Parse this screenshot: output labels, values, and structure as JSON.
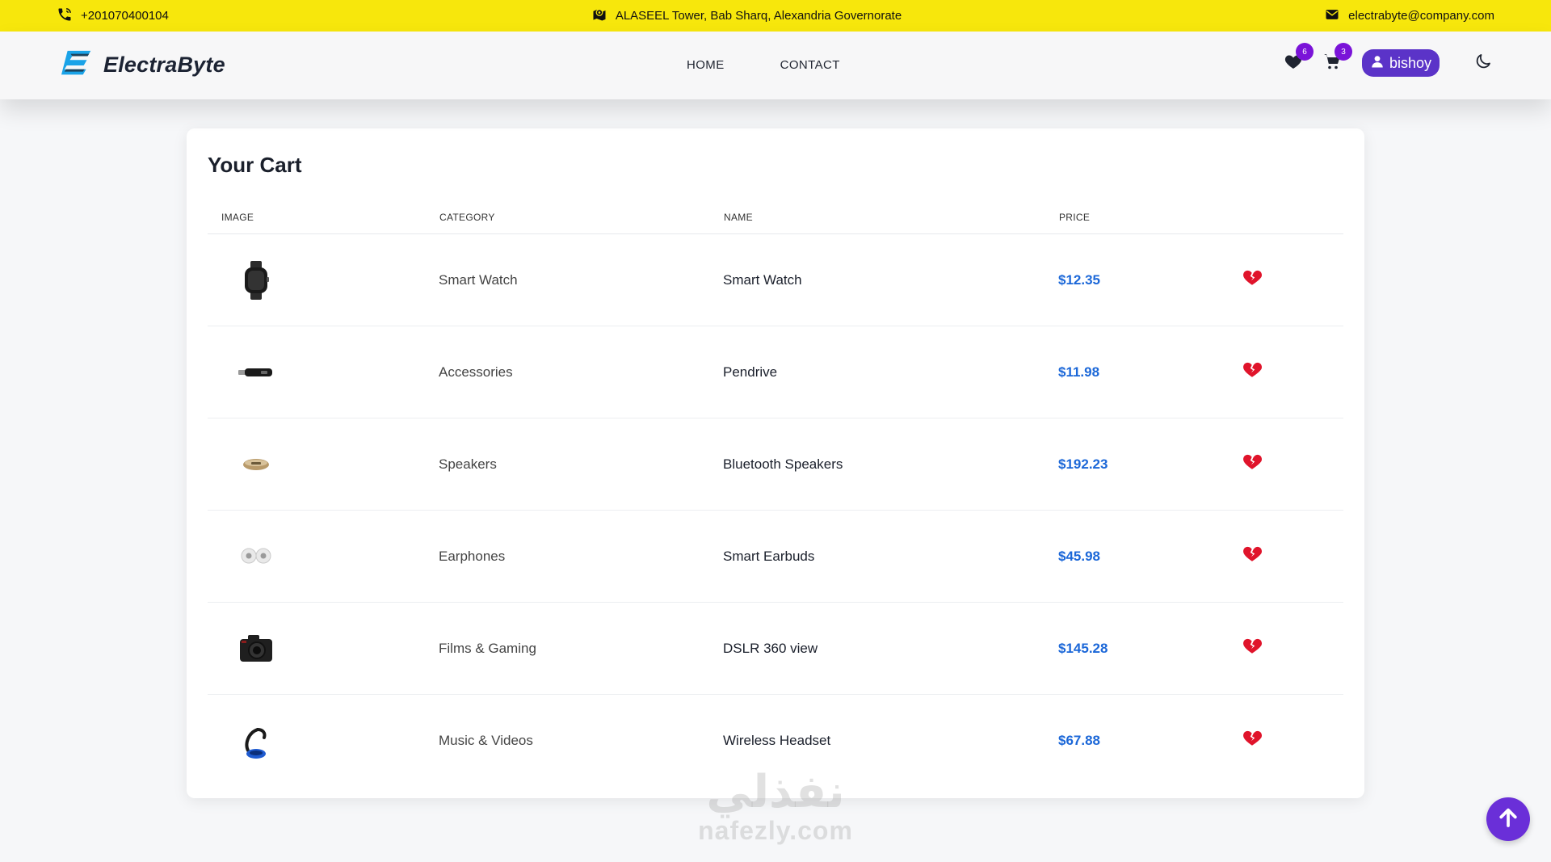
{
  "topbar": {
    "phone": "+201070400104",
    "address": "ALASEEL Tower, Bab Sharq, Alexandria Governorate",
    "email": "electrabyte@company.com",
    "background": "#f7e70c"
  },
  "nav": {
    "brand": "ElectraByte",
    "links": [
      {
        "label": "HOME"
      },
      {
        "label": "CONTACT"
      }
    ],
    "wishlist_count": "6",
    "cart_count": "3",
    "user_label": "bishoy",
    "accent": "#5b33c8"
  },
  "cart": {
    "title": "Your Cart",
    "columns": [
      "IMAGE",
      "CATEGORY",
      "NAME",
      "PRICE"
    ],
    "items": [
      {
        "image_icon": "smart-watch-icon",
        "category": "Smart Watch",
        "name": "Smart Watch",
        "price": "$12.35"
      },
      {
        "image_icon": "pendrive-icon",
        "category": "Accessories",
        "name": "Pendrive",
        "price": "$11.98"
      },
      {
        "image_icon": "speaker-icon",
        "category": "Speakers",
        "name": "Bluetooth Speakers",
        "price": "$192.23"
      },
      {
        "image_icon": "earbuds-icon",
        "category": "Earphones",
        "name": "Smart Earbuds",
        "price": "$45.98"
      },
      {
        "image_icon": "camera-icon",
        "category": "Films & Gaming",
        "name": "DSLR 360 view",
        "price": "$145.28"
      },
      {
        "image_icon": "headset-icon",
        "category": "Music & Videos",
        "name": "Wireless Headset",
        "price": "$67.88"
      }
    ],
    "price_color": "#1b67d8",
    "remove_icon": "broken-heart-icon",
    "remove_color": "#e0142b"
  },
  "watermark": {
    "arabic": "نفذلي",
    "latin": "nafezly.com"
  }
}
